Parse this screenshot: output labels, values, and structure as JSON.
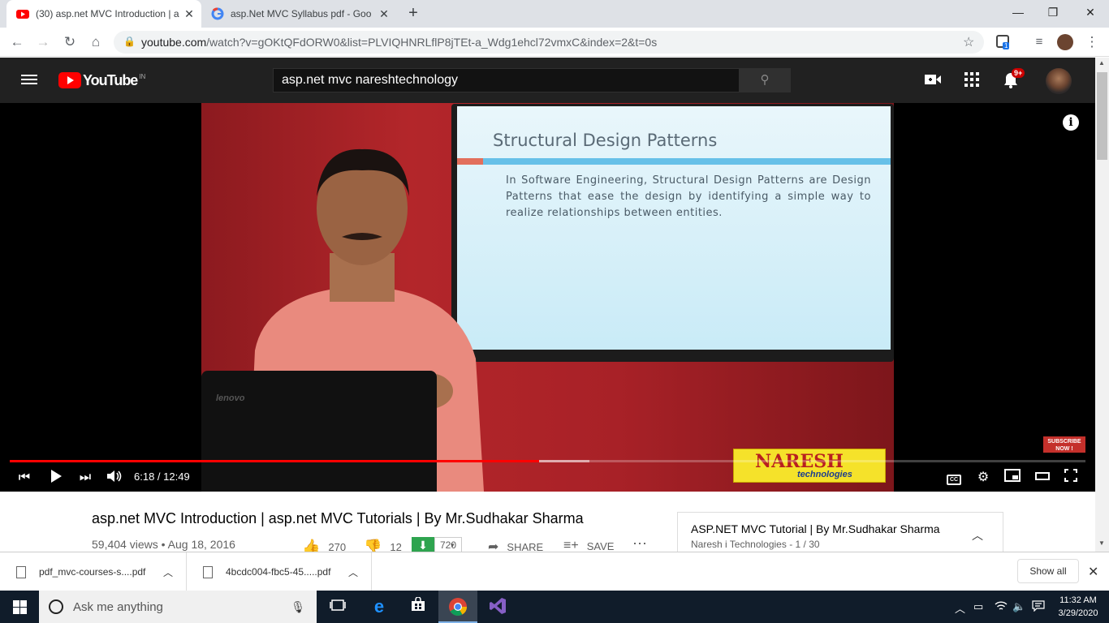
{
  "browser": {
    "tabs": [
      {
        "title": "(30) asp.net MVC Introduction | a",
        "active": true
      },
      {
        "title": "asp.Net MVC Syllabus pdf - Goo",
        "active": false
      }
    ],
    "new_tab": "+",
    "window": {
      "minimize": "—",
      "restore": "❐",
      "close": "✕"
    },
    "url": {
      "host": "youtube.com",
      "path": "/watch?v=gOKtQFdORW0&list=PLVIQHNRLflP8jTEt-a_Wdg1ehcl72vmxC&index=2&t=0s"
    },
    "extension_badge": "1"
  },
  "youtube": {
    "logo": "YouTube",
    "country": "IN",
    "search_value": "asp.net mvc nareshtechnology",
    "notifications": "9+",
    "video": {
      "slide_title": "Structural Design Patterns",
      "slide_text": "In Software Engineering, Structural Design Patterns are Design Patterns that ease the design by identifying a simple way to realize relationships between entities.",
      "laptop_brand": "lenovo",
      "watermark_name": "NARESH",
      "watermark_sub": "technologies",
      "subscribe_badge": "SUBSCRIBE",
      "subscribe_sub": "NOW !",
      "time": "6:18 / 12:49",
      "progress_fraction": 0.492,
      "buffer_fraction": 0.539,
      "cc": "CC"
    },
    "title": "asp.net MVC Introduction | asp.net MVC Tutorials | By Mr.Sudhakar Sharma",
    "views": "59,404 views",
    "date": "Aug 18, 2016",
    "likes": "270",
    "dislikes": "12",
    "download_count": "720",
    "share": "SHARE",
    "save": "SAVE",
    "playlist": {
      "title": "ASP.NET MVC Tutorial | By Mr.Sudhakar Sharma",
      "channel": "Naresh i Technologies",
      "position": "1 / 30"
    }
  },
  "downloads": {
    "items": [
      "pdf_mvc-courses-s....pdf",
      "4bcdc004-fbc5-45.....pdf"
    ],
    "show_all": "Show all"
  },
  "taskbar": {
    "search_placeholder": "Ask me anything",
    "time": "11:32 AM",
    "date": "3/29/2020"
  }
}
